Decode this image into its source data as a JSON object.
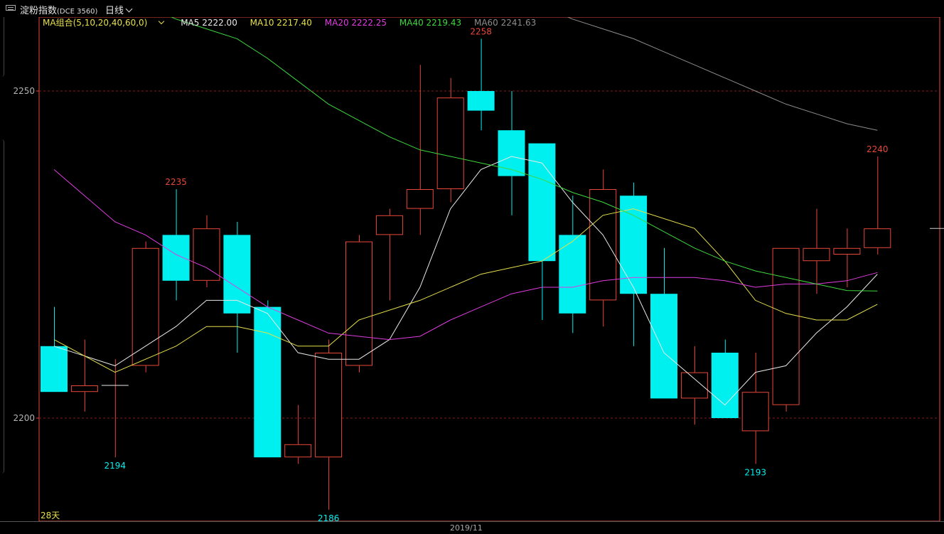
{
  "header": {
    "instrument_name": "淀粉指数",
    "instrument_code": "(DCE 3560)",
    "period": "日线"
  },
  "ma_legend": {
    "title": "MA组合(5,10,20,40,60,0)",
    "items": [
      {
        "label": "MA5 2222.00",
        "color": "#e8e8e8"
      },
      {
        "label": "MA10 2217.40",
        "color": "#e6e04a"
      },
      {
        "label": "MA20 2222.25",
        "color": "#e03ce0"
      },
      {
        "label": "MA40 2219.43",
        "color": "#3cd83c"
      },
      {
        "label": "MA60 2241.63",
        "color": "#8c8c8c"
      }
    ]
  },
  "footer": {
    "period_count": "28天",
    "date_label": "2019/11"
  },
  "colors": {
    "up": "#e8473a",
    "down": "#00f0f0",
    "grid": "#8a1a1a",
    "axis_text": "#b4b4b4"
  },
  "chart_data": {
    "type": "candlestick",
    "ylim": [
      2180,
      2265
    ],
    "y_ticks": [
      2200,
      2250
    ],
    "candles": [
      {
        "o": 2211,
        "h": 2217,
        "l": 2204,
        "c": 2204
      },
      {
        "o": 2204,
        "h": 2212,
        "l": 2201,
        "c": 2205
      },
      {
        "o": 2205,
        "h": 2209,
        "l": 2194,
        "c": 2205
      },
      {
        "o": 2208,
        "h": 2227,
        "l": 2207,
        "c": 2226
      },
      {
        "o": 2228,
        "h": 2235,
        "l": 2218,
        "c": 2221
      },
      {
        "o": 2221,
        "h": 2231,
        "l": 2220,
        "c": 2229
      },
      {
        "o": 2228,
        "h": 2230,
        "l": 2210,
        "c": 2216
      },
      {
        "o": 2217,
        "h": 2218,
        "l": 2194,
        "c": 2194
      },
      {
        "o": 2194,
        "h": 2202,
        "l": 2193,
        "c": 2196
      },
      {
        "o": 2194,
        "h": 2212,
        "l": 2186,
        "c": 2210
      },
      {
        "o": 2208,
        "h": 2228,
        "l": 2207,
        "c": 2227
      },
      {
        "o": 2228,
        "h": 2232,
        "l": 2218,
        "c": 2231
      },
      {
        "o": 2232,
        "h": 2254,
        "l": 2228,
        "c": 2235
      },
      {
        "o": 2235,
        "h": 2252,
        "l": 2233,
        "c": 2249
      },
      {
        "o": 2250,
        "h": 2258,
        "l": 2244,
        "c": 2247
      },
      {
        "o": 2244,
        "h": 2250,
        "l": 2231,
        "c": 2237
      },
      {
        "o": 2242,
        "h": 2242,
        "l": 2215,
        "c": 2224
      },
      {
        "o": 2228,
        "h": 2234,
        "l": 2213,
        "c": 2216
      },
      {
        "o": 2218,
        "h": 2238,
        "l": 2214,
        "c": 2235
      },
      {
        "o": 2234,
        "h": 2236,
        "l": 2211,
        "c": 2219
      },
      {
        "o": 2219,
        "h": 2226,
        "l": 2203,
        "c": 2203
      },
      {
        "o": 2203,
        "h": 2211,
        "l": 2199,
        "c": 2207
      },
      {
        "o": 2210,
        "h": 2212,
        "l": 2200,
        "c": 2200
      },
      {
        "o": 2198,
        "h": 2210,
        "l": 2193,
        "c": 2204
      },
      {
        "o": 2202,
        "h": 2226,
        "l": 2201,
        "c": 2226
      },
      {
        "o": 2224,
        "h": 2232,
        "l": 2219,
        "c": 2226
      },
      {
        "o": 2225,
        "h": 2229,
        "l": 2220,
        "c": 2226
      },
      {
        "o": 2226,
        "h": 2240,
        "l": 2225,
        "c": 2229
      }
    ],
    "extreme_labels": [
      {
        "index": 4,
        "value": "2235",
        "type": "high"
      },
      {
        "index": 14,
        "value": "2258",
        "type": "high"
      },
      {
        "index": 27,
        "value": "2240",
        "type": "high"
      },
      {
        "index": 2,
        "value": "2194",
        "type": "low"
      },
      {
        "index": 9,
        "value": "2186",
        "type": "low"
      },
      {
        "index": 23,
        "value": "2193",
        "type": "low"
      }
    ],
    "ma_series": [
      {
        "key": "ma5",
        "color": "#e8e8e8",
        "values": [
          [
            0,
            2211
          ],
          [
            2,
            2208
          ],
          [
            4,
            2214
          ],
          [
            5,
            2218
          ],
          [
            6,
            2218
          ],
          [
            7,
            2216
          ],
          [
            8,
            2210
          ],
          [
            9,
            2209
          ],
          [
            10,
            2209
          ],
          [
            11,
            2212
          ],
          [
            12,
            2220
          ],
          [
            13,
            2232
          ],
          [
            14,
            2238
          ],
          [
            15,
            2240
          ],
          [
            16,
            2239
          ],
          [
            17,
            2233
          ],
          [
            18,
            2228
          ],
          [
            19,
            2220
          ],
          [
            20,
            2210
          ],
          [
            21,
            2206
          ],
          [
            22,
            2202
          ],
          [
            23,
            2207
          ],
          [
            24,
            2208
          ],
          [
            25,
            2213
          ],
          [
            26,
            2217
          ],
          [
            27,
            2222
          ]
        ]
      },
      {
        "key": "ma10",
        "color": "#e6e04a",
        "values": [
          [
            0,
            2212
          ],
          [
            2,
            2207
          ],
          [
            3,
            2209
          ],
          [
            4,
            2211
          ],
          [
            5,
            2214
          ],
          [
            6,
            2214
          ],
          [
            7,
            2213
          ],
          [
            8,
            2211
          ],
          [
            9,
            2211
          ],
          [
            10,
            2215
          ],
          [
            12,
            2218
          ],
          [
            14,
            2222
          ],
          [
            15,
            2223
          ],
          [
            16,
            2224
          ],
          [
            17,
            2227
          ],
          [
            18,
            2231
          ],
          [
            19,
            2232
          ],
          [
            21,
            2229
          ],
          [
            22,
            2224
          ],
          [
            23,
            2218
          ],
          [
            24,
            2216
          ],
          [
            25,
            2215
          ],
          [
            26,
            2215
          ],
          [
            27,
            2217.4
          ]
        ]
      },
      {
        "key": "ma20",
        "color": "#e03ce0",
        "values": [
          [
            0,
            2238
          ],
          [
            1,
            2234
          ],
          [
            2,
            2230
          ],
          [
            3,
            2228
          ],
          [
            4,
            2225
          ],
          [
            5,
            2223
          ],
          [
            6,
            2220
          ],
          [
            7,
            2217
          ],
          [
            8,
            2215
          ],
          [
            9,
            2213
          ],
          [
            10,
            2212.5
          ],
          [
            11,
            2212
          ],
          [
            12,
            2212.5
          ],
          [
            13,
            2215
          ],
          [
            14,
            2217
          ],
          [
            15,
            2219
          ],
          [
            16,
            2220
          ],
          [
            17,
            2220
          ],
          [
            18,
            2221
          ],
          [
            19,
            2221.5
          ],
          [
            20,
            2221.5
          ],
          [
            21,
            2221.5
          ],
          [
            22,
            2221
          ],
          [
            23,
            2220
          ],
          [
            24,
            2220.5
          ],
          [
            25,
            2220.5
          ],
          [
            26,
            2221
          ],
          [
            27,
            2222.25
          ]
        ]
      },
      {
        "key": "ma40",
        "color": "#3cd83c",
        "values": [
          [
            3,
            2263
          ],
          [
            4,
            2261
          ],
          [
            5,
            2259.5
          ],
          [
            6,
            2258
          ],
          [
            7,
            2255
          ],
          [
            8,
            2251.5
          ],
          [
            9,
            2248
          ],
          [
            10,
            2245.5
          ],
          [
            11,
            2243
          ],
          [
            12,
            2241
          ],
          [
            13,
            2240
          ],
          [
            14,
            2239
          ],
          [
            15,
            2238
          ],
          [
            16,
            2236.5
          ],
          [
            17,
            2234.5
          ],
          [
            18,
            2233
          ],
          [
            19,
            2231
          ],
          [
            20,
            2228.5
          ],
          [
            21,
            2226
          ],
          [
            22,
            2224
          ],
          [
            23,
            2222.5
          ],
          [
            24,
            2221.5
          ],
          [
            25,
            2220.5
          ],
          [
            26,
            2219.5
          ],
          [
            27,
            2219.43
          ]
        ]
      },
      {
        "key": "ma60",
        "color": "#8c8c8c",
        "values": [
          [
            16,
            2263
          ],
          [
            17,
            2261
          ],
          [
            18,
            2259.5
          ],
          [
            19,
            2258
          ],
          [
            20,
            2256
          ],
          [
            21,
            2254
          ],
          [
            22,
            2252
          ],
          [
            23,
            2250
          ],
          [
            24,
            2248
          ],
          [
            25,
            2246.5
          ],
          [
            26,
            2245
          ],
          [
            27,
            2244
          ]
        ]
      }
    ],
    "last_price_marker": 2229
  }
}
